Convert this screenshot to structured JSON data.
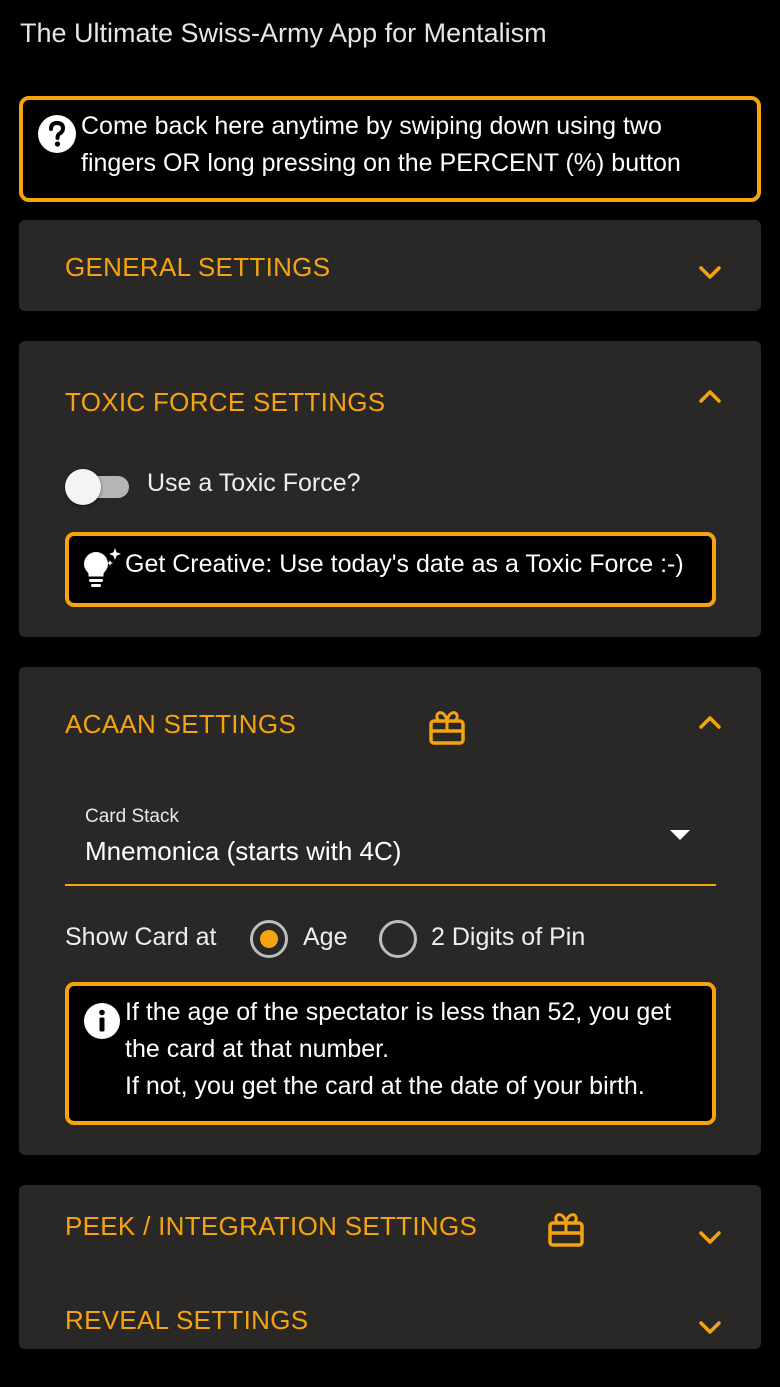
{
  "app": {
    "tagline": "The Ultimate Swiss-Army App for Mentalism"
  },
  "help_callout": {
    "icon": "question-circle-icon",
    "text_line1": "Come back here anytime by swiping down using two",
    "text_line2": "fingers OR long pressing on the PERCENT (%) button"
  },
  "sections": {
    "general": {
      "title": "GENERAL SETTINGS",
      "expanded": false
    },
    "toxic_force": {
      "title": "TOXIC FORCE SETTINGS",
      "expanded": true,
      "toggle_label": "Use a Toxic Force?",
      "toggle_on": false,
      "tip_icon": "lightbulb-sparkle-icon",
      "tip_text": "Get Creative: Use today's date as a Toxic Force :-)"
    },
    "acaan": {
      "title": "ACAAN SETTINGS",
      "badge_icon": "gift-icon",
      "expanded": true,
      "stack_caption": "Card Stack",
      "stack_value": "Mnemonica (starts with 4C)",
      "show_card_label": "Show Card at",
      "option_age": "Age",
      "option_pin": "2 Digits of Pin",
      "selected_option": "Age",
      "info_icon": "info-circle-icon",
      "info_line1": "If the age of the spectator is less than 52, you get",
      "info_line2": "the card at that number.",
      "info_line3": "If not, you get the card at the date of your birth."
    },
    "peek": {
      "title": "PEEK / INTEGRATION SETTINGS",
      "badge_icon": "gift-icon",
      "expanded": false
    },
    "reveal": {
      "title": "REVEAL SETTINGS",
      "expanded": false
    }
  },
  "colors": {
    "accent": "#f5a30f",
    "panel": "#2a2827",
    "background": "#000000"
  }
}
